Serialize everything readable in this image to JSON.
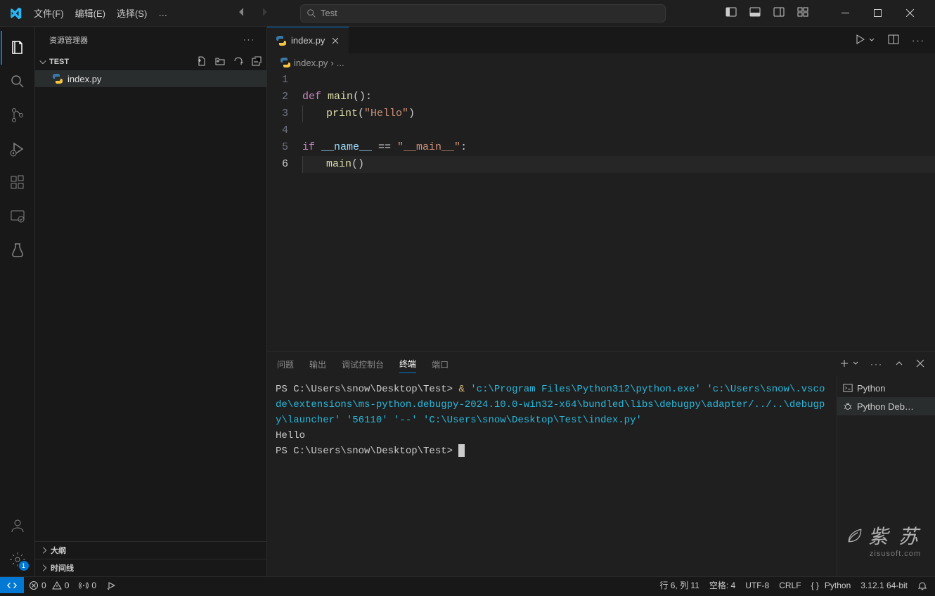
{
  "menu": {
    "file": "文件(F)",
    "edit": "编辑(E)",
    "select": "选择(S)",
    "more": "…"
  },
  "search_placeholder": "Test",
  "sidebar": {
    "title": "资源管理器",
    "folder": "TEST",
    "file": "index.py",
    "outline": "大纲",
    "timeline": "时间线",
    "badge": "1"
  },
  "tab": {
    "name": "index.py"
  },
  "breadcrumb": {
    "file": "index.py",
    "sep": "›",
    "more": "..."
  },
  "code_lines": [
    "1",
    "2",
    "3",
    "4",
    "5",
    "6"
  ],
  "code": {
    "l2_def": "def ",
    "l2_main": "main",
    "l2_p": "():",
    "l3_print": "print",
    "l3_p1": "(",
    "l3_str": "\"Hello\"",
    "l3_p2": ")",
    "l5_if": "if ",
    "l5_name": "__name__",
    "l5_eq": " == ",
    "l5_main": "\"__main__\"",
    "l5_colon": ":",
    "l6_main": "main",
    "l6_p": "()"
  },
  "panel_tabs": {
    "problems": "问题",
    "output": "输出",
    "debug": "调试控制台",
    "terminal": "终端",
    "ports": "端口"
  },
  "terminal": {
    "prompt1": "PS C:\\Users\\snow\\Desktop\\Test> ",
    "amp": " & ",
    "cmd": "'c:\\Program Files\\Python312\\python.exe' 'c:\\Users\\snow\\.vscode\\extensions\\ms-python.debugpy-2024.10.0-win32-x64\\bundled\\libs\\debugpy\\adapter/../..\\debugpy\\launcher' '56110' '--' 'C:\\Users\\snow\\Desktop\\Test\\index.py'",
    "out": "Hello",
    "prompt2": "PS C:\\Users\\snow\\Desktop\\Test> ",
    "list_python": "Python",
    "list_debug": "Python Deb…"
  },
  "status": {
    "errors": "0",
    "warnings": "0",
    "ports": "0",
    "pos": "行 6, 列 11",
    "spaces": "空格: 4",
    "encoding": "UTF-8",
    "eol": "CRLF",
    "lang": "Python",
    "py": "3.12.1 64-bit"
  },
  "watermark": {
    "name": "紫 苏",
    "url": "zisusoft.com"
  }
}
